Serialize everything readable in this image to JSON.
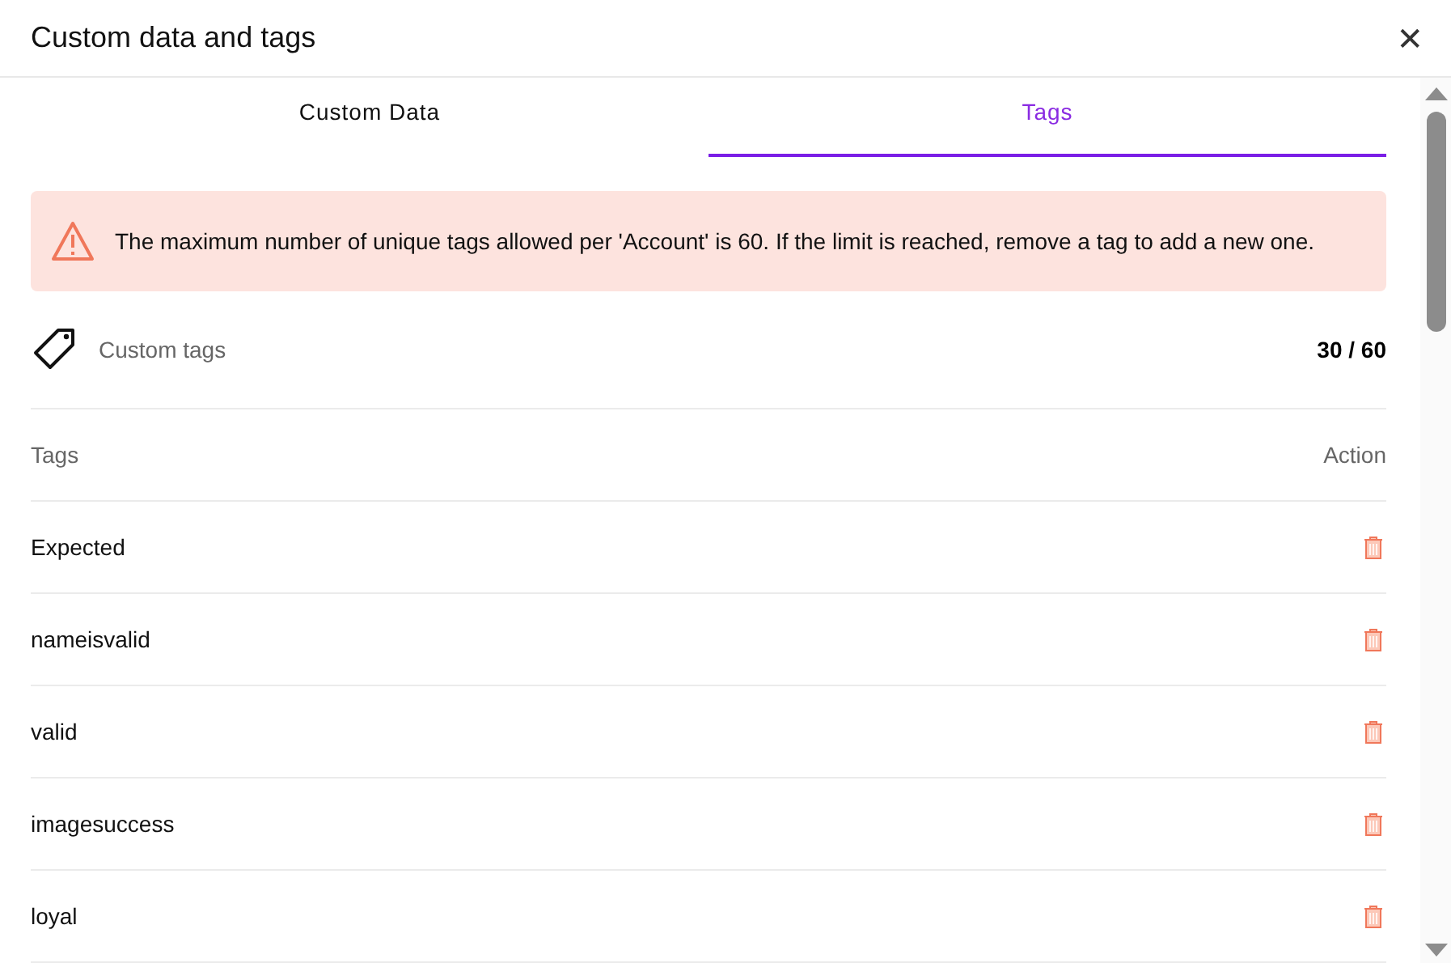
{
  "window": {
    "title": "Custom data and tags",
    "close": "✕"
  },
  "tabs": [
    {
      "label": "Custom Data",
      "selected": false
    },
    {
      "label": "Tags",
      "selected": true
    }
  ],
  "alert": {
    "message": "The maximum number of unique tags allowed per 'Account' is 60. If the limit is reached, remove a tag to add a new one."
  },
  "summary": {
    "label": "Custom tags",
    "count": "30 / 60"
  },
  "table": {
    "columns": [
      "Tags",
      "Action"
    ],
    "rows": [
      {
        "tag": "Expected"
      },
      {
        "tag": "nameisvalid"
      },
      {
        "tag": "valid"
      },
      {
        "tag": "imagesuccess"
      },
      {
        "tag": "loyal"
      }
    ]
  }
}
